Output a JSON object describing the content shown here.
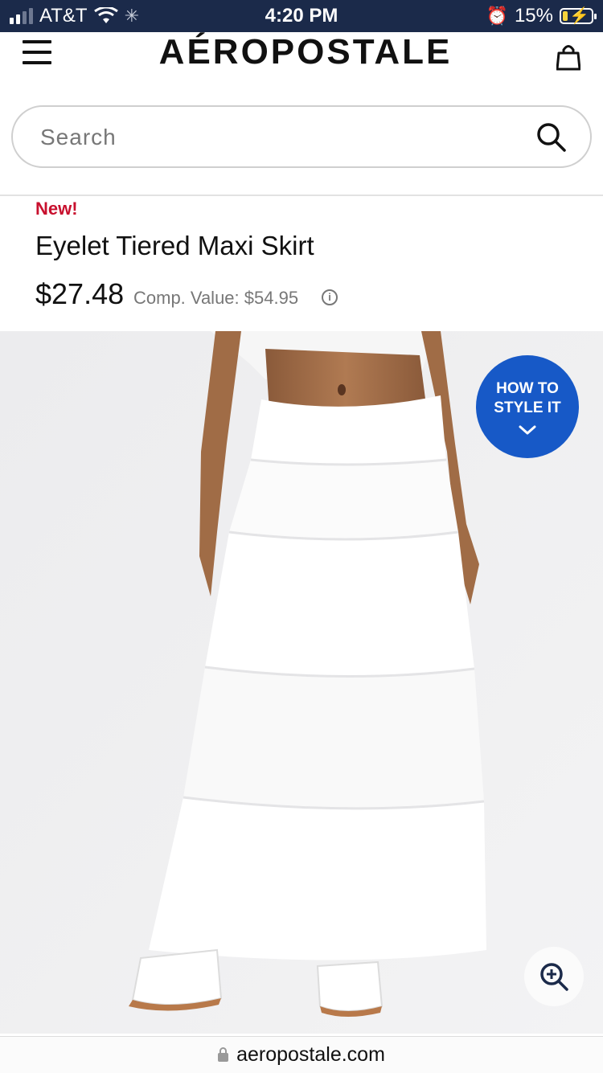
{
  "status_bar": {
    "carrier": "AT&T",
    "time": "4:20 PM",
    "battery_percent": "15%"
  },
  "header": {
    "brand": "AÉROPOSTALE",
    "menu_icon": "hamburger-icon",
    "cart_icon": "shopping-bag-icon"
  },
  "search": {
    "placeholder": "Search",
    "icon": "search-icon"
  },
  "product": {
    "badge": "New!",
    "title": "Eyelet Tiered Maxi Skirt",
    "price": "$27.48",
    "comp_value": "Comp. Value: $54.95",
    "info_icon": "info-icon"
  },
  "style_button": {
    "line1": "HOW TO",
    "line2": "STYLE IT",
    "icon": "chevron-down-icon",
    "color": "#1759c7"
  },
  "zoom_button": {
    "icon": "zoom-in-icon"
  },
  "browser": {
    "url": "aeropostale.com"
  },
  "colors": {
    "status_bar_bg": "#1b2a4a",
    "new_badge": "#c8102e",
    "style_button": "#1759c7"
  }
}
